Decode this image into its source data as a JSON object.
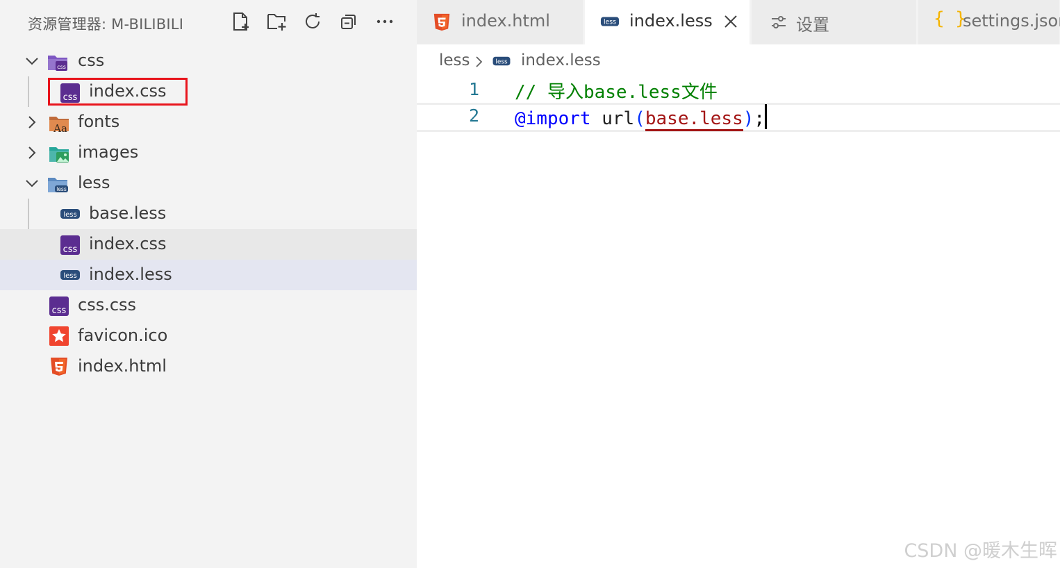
{
  "explorer": {
    "title": "资源管理器: M-BILIBILI",
    "actions": [
      {
        "name": "new-file-icon"
      },
      {
        "name": "new-folder-icon"
      },
      {
        "name": "refresh-icon"
      },
      {
        "name": "collapse-all-icon"
      },
      {
        "name": "more-actions-icon"
      }
    ],
    "tree": [
      {
        "label": "css",
        "kind": "folder",
        "state": "expanded",
        "icon": "css-folder-icon",
        "color": "#6f4bb3"
      },
      {
        "label": "index.css",
        "kind": "file",
        "icon": "css-file-icon",
        "color": "#5b2d90"
      },
      {
        "label": "fonts",
        "kind": "folder",
        "state": "collapsed",
        "icon": "fonts-folder-icon",
        "color": "#c06b3a"
      },
      {
        "label": "images",
        "kind": "folder",
        "state": "collapsed",
        "icon": "images-folder-icon",
        "color": "#2aa68a"
      },
      {
        "label": "less",
        "kind": "folder",
        "state": "expanded",
        "icon": "less-folder-icon",
        "color": "#3c6ea5"
      },
      {
        "label": "base.less",
        "kind": "file",
        "icon": "less-file-icon",
        "color": "#2a4d7a"
      },
      {
        "label": "index.css",
        "kind": "file",
        "icon": "css-file-icon",
        "color": "#5b2d90"
      },
      {
        "label": "index.less",
        "kind": "file",
        "icon": "less-file-icon",
        "color": "#2a4d7a",
        "selected": true
      },
      {
        "label": "css.css",
        "kind": "file",
        "icon": "css-file-icon",
        "color": "#5b2d90"
      },
      {
        "label": "favicon.ico",
        "kind": "file",
        "icon": "star-icon",
        "color": "#f0452f"
      },
      {
        "label": "index.html",
        "kind": "file",
        "icon": "html5-icon",
        "color": "#e44d26"
      }
    ]
  },
  "tabs": [
    {
      "label": "index.html",
      "icon": "html5-icon",
      "active": false
    },
    {
      "label": "index.less",
      "icon": "less-file-icon",
      "active": true
    },
    {
      "label": "设置",
      "icon": "settings-sliders-icon",
      "active": false
    },
    {
      "label": "settings.json",
      "icon": "json-braces-icon",
      "active": false
    }
  ],
  "breadcrumb": {
    "folder": "less",
    "file": "index.less"
  },
  "code": {
    "line1": {
      "number": "1",
      "text": "// 导入base.less文件"
    },
    "line2": {
      "number": "2",
      "at_rule": "@import",
      "fn": "url",
      "paren_open": "(",
      "arg": "base.less",
      "paren_close": ")",
      "semicolon": ";"
    }
  },
  "watermark": "CSDN @暖木生晖",
  "colors": {
    "highlight_box": "#e8141c",
    "comment": "#008000",
    "keyword": "#0000ff",
    "string": "#a31515",
    "line_number": "#237893"
  }
}
